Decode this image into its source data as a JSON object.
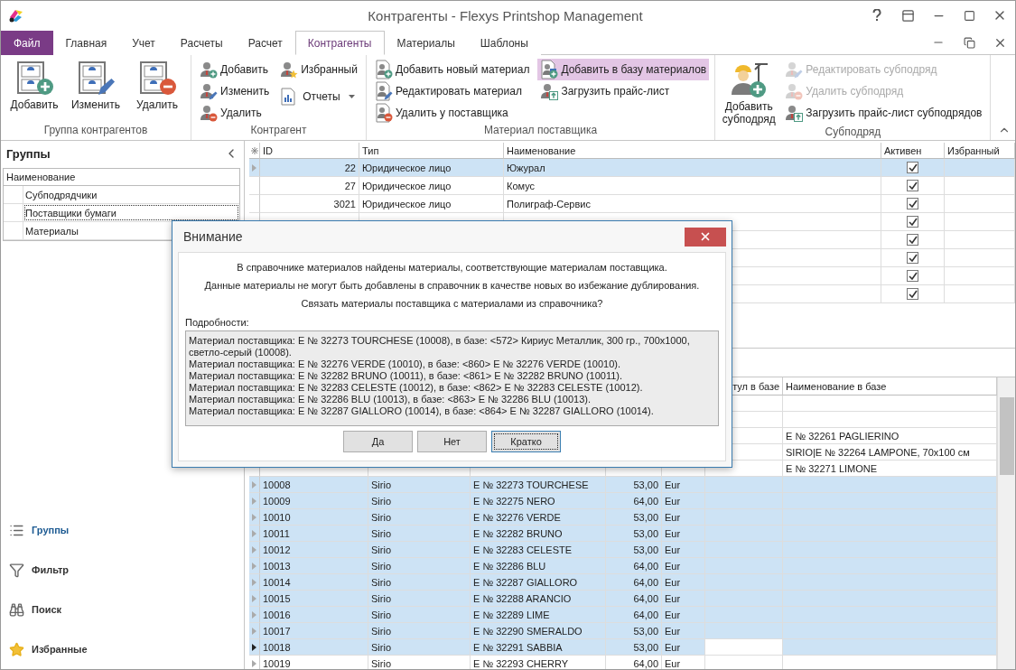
{
  "window": {
    "title": "Контрагенты - Flexys Printshop Management"
  },
  "ribbon_tabs": [
    {
      "label": "Файл",
      "kind": "file",
      "selected": false
    },
    {
      "label": "Главная",
      "kind": "tab",
      "selected": false
    },
    {
      "label": "Учет",
      "kind": "tab",
      "selected": false
    },
    {
      "label": "Расчеты",
      "kind": "tab",
      "selected": false
    },
    {
      "label": "Расчет",
      "kind": "tab",
      "selected": false
    },
    {
      "label": "Контрагенты",
      "kind": "tab",
      "selected": true
    },
    {
      "label": "Материалы",
      "kind": "tab",
      "selected": false
    },
    {
      "label": "Шаблоны",
      "kind": "tab",
      "selected": false
    }
  ],
  "ribbon_groups": [
    {
      "label": "Группа контрагентов",
      "columns": [
        [
          {
            "kind": "large",
            "label": "Добавить",
            "disabled": false,
            "highlighted": false
          }
        ],
        [
          {
            "kind": "large",
            "label": "Изменить",
            "disabled": false,
            "highlighted": false
          }
        ],
        [
          {
            "kind": "large",
            "label": "Удалить",
            "disabled": false,
            "highlighted": false
          }
        ]
      ]
    },
    {
      "label": "Контрагент",
      "columns": [
        [
          {
            "kind": "small",
            "label": "Добавить",
            "disabled": false,
            "highlighted": false
          },
          {
            "kind": "small",
            "label": "Изменить",
            "disabled": false,
            "highlighted": false
          },
          {
            "kind": "small",
            "label": "Удалить",
            "disabled": false,
            "highlighted": false
          }
        ],
        [
          {
            "kind": "small",
            "label": "Избранный",
            "disabled": false,
            "highlighted": false
          },
          {
            "kind": "menu",
            "label": "Отчеты",
            "disabled": false,
            "highlighted": false
          }
        ]
      ]
    },
    {
      "label": "Материал поставщика",
      "columns": [
        [
          {
            "kind": "small",
            "label": "Добавить новый материал",
            "disabled": false,
            "highlighted": false
          },
          {
            "kind": "small",
            "label": "Редактировать материал",
            "disabled": false,
            "highlighted": false
          },
          {
            "kind": "small",
            "label": "Удалить у поставщика",
            "disabled": false,
            "highlighted": false
          }
        ],
        [
          {
            "kind": "small",
            "label": "Добавить в базу материалов",
            "disabled": false,
            "highlighted": true
          },
          {
            "kind": "small",
            "label": "Загрузить прайс-лист",
            "disabled": false,
            "highlighted": false
          }
        ]
      ]
    },
    {
      "label": "Субподряд",
      "columns": [
        [
          {
            "kind": "large",
            "label": "Добавить субподряд",
            "disabled": false,
            "highlighted": false
          }
        ],
        [
          {
            "kind": "small",
            "label": "Редактировать субподряд",
            "disabled": true,
            "highlighted": false
          },
          {
            "kind": "small",
            "label": "Удалить субподряд",
            "disabled": true,
            "highlighted": false
          },
          {
            "kind": "small",
            "label": "Загрузить прайс-лист субподрядов",
            "disabled": false,
            "highlighted": false
          }
        ]
      ]
    }
  ],
  "groups_panel": {
    "title": "Группы",
    "tree_header": "Наименование",
    "items": [
      {
        "label": "Субподрядчики",
        "selected": false
      },
      {
        "label": "Поставщики бумаги",
        "selected": true
      },
      {
        "label": "Материалы",
        "selected": false
      }
    ]
  },
  "nav": [
    {
      "label": "Группы",
      "selected": true
    },
    {
      "label": "Фильтр",
      "selected": false
    },
    {
      "label": "Поиск",
      "selected": false
    },
    {
      "label": "Избранные",
      "selected": false
    }
  ],
  "contractors_table": {
    "columns": [
      "ID",
      "Тип",
      "Наименование",
      "Активен",
      "Избранный"
    ],
    "rows": [
      {
        "id": "22",
        "type": "Юридическое лицо",
        "name": "Южурал",
        "active": true,
        "selected": true
      },
      {
        "id": "27",
        "type": "Юридическое лицо",
        "name": "Комус",
        "active": true,
        "selected": false
      },
      {
        "id": "3021",
        "type": "Юридическое лицо",
        "name": "Полиграф-Сервис",
        "active": true,
        "selected": false
      },
      {
        "active": true,
        "selected": false
      },
      {
        "active": true,
        "selected": false
      },
      {
        "active": true,
        "selected": false
      },
      {
        "active": true,
        "selected": false
      },
      {
        "active": true,
        "selected": false
      }
    ]
  },
  "materials_table": {
    "columns": [
      "тул в базе",
      "Наименование в базе"
    ],
    "rows": [
      {
        "selected": false
      },
      {
        "selected": false
      },
      {
        "name_in_base": "E № 32261 PAGLIERINO",
        "selected": false
      },
      {
        "name_in_base": "SIRIO|E № 32264 LAMPONE, 70x100 см",
        "selected": false
      },
      {
        "name_in_base": "E № 32271 LIMONE",
        "selected": false
      },
      {
        "column_1": "10008",
        "column_2": "Sirio",
        "column_3": "E № 32273 TOURCHESE",
        "column_4": "53,00",
        "column_5": "Eur",
        "selected": true,
        "current": false
      },
      {
        "column_1": "10009",
        "column_2": "Sirio",
        "column_3": "E № 32275 NERO",
        "column_4": "64,00",
        "column_5": "Eur",
        "selected": true,
        "current": false
      },
      {
        "column_1": "10010",
        "column_2": "Sirio",
        "column_3": "E № 32276 VERDE",
        "column_4": "53,00",
        "column_5": "Eur",
        "selected": true,
        "current": false
      },
      {
        "column_1": "10011",
        "column_2": "Sirio",
        "column_3": "E № 32282 BRUNO",
        "column_4": "53,00",
        "column_5": "Eur",
        "selected": true,
        "current": false
      },
      {
        "column_1": "10012",
        "column_2": "Sirio",
        "column_3": "E № 32283 CELESTE",
        "column_4": "53,00",
        "column_5": "Eur",
        "selected": true,
        "current": false
      },
      {
        "column_1": "10013",
        "column_2": "Sirio",
        "column_3": "E № 32286 BLU",
        "column_4": "64,00",
        "column_5": "Eur",
        "selected": true,
        "current": false
      },
      {
        "column_1": "10014",
        "column_2": "Sirio",
        "column_3": "E № 32287 GIALLORO",
        "column_4": "64,00",
        "column_5": "Eur",
        "selected": true,
        "current": false
      },
      {
        "column_1": "10015",
        "column_2": "Sirio",
        "column_3": "E № 32288 ARANCIO",
        "column_4": "64,00",
        "column_5": "Eur",
        "selected": true,
        "current": false
      },
      {
        "column_1": "10016",
        "column_2": "Sirio",
        "column_3": "E № 32289 LIME",
        "column_4": "64,00",
        "column_5": "Eur",
        "selected": true,
        "current": false
      },
      {
        "column_1": "10017",
        "column_2": "Sirio",
        "column_3": "E № 32290 SMERALDO",
        "column_4": "53,00",
        "column_5": "Eur",
        "selected": true,
        "current": false
      },
      {
        "column_1": "10018",
        "column_2": "Sirio",
        "column_3": "E № 32291 SABBIA",
        "column_4": "53,00",
        "column_5": "Eur",
        "selected": true,
        "current": true
      },
      {
        "column_1": "10019",
        "column_2": "Sirio",
        "column_3": "E № 32293 CHERRY",
        "column_4": "64,00",
        "column_5": "Eur",
        "selected": false,
        "current": false
      }
    ]
  },
  "dialog": {
    "title": "Внимание",
    "messages": [
      "В справочнике материалов найдены материалы, соответствующие материалам поставщика.",
      "Данные материалы не могут быть добавлены в справочник в качестве новых во избежание дублирования.",
      "Связать материалы поставщика с материалами из справочника?"
    ],
    "details_label": "Подробности:",
    "details": [
      "Материал поставщика: E № 32273 TOURCHESE (10008), в базе: <572> Кириус Металлик, 300 гр., 700x1000, светло-серый (10008).",
      "Материал поставщика: E № 32276 VERDE (10010), в базе: <860> E № 32276 VERDE (10010).",
      "Материал поставщика: E № 32282 BRUNO (10011), в базе: <861> E № 32282 BRUNO (10011).",
      "Материал поставщика: E № 32283 CELESTE (10012), в базе: <862> E № 32283 CELESTE (10012).",
      "Материал поставщика: E № 32286 BLU (10013), в базе: <863> E № 32286 BLU (10013).",
      "Материал поставщика: E № 32287 GIALLORO (10014), в базе: <864> E № 32287 GIALLORO (10014)."
    ],
    "buttons": [
      {
        "label": "Да",
        "focused": false
      },
      {
        "label": "Нет",
        "focused": false
      },
      {
        "label": "Кратко",
        "focused": true
      }
    ]
  }
}
